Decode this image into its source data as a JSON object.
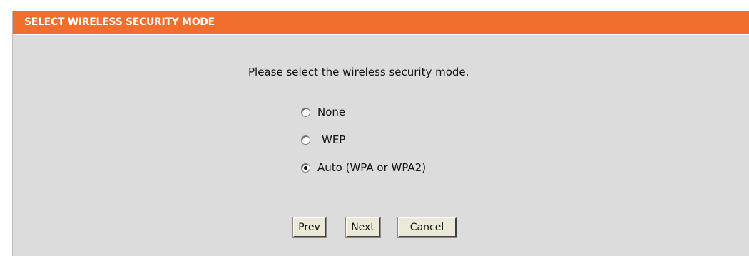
{
  "header": {
    "title": "SELECT WIRELESS SECURITY MODE"
  },
  "main": {
    "prompt": "Please select the wireless security mode.",
    "options": [
      {
        "label": "None",
        "selected": false
      },
      {
        "label": "WEP",
        "selected": false
      },
      {
        "label": "Auto (WPA or WPA2)",
        "selected": true
      }
    ]
  },
  "buttons": {
    "prev": "Prev",
    "next": "Next",
    "cancel": "Cancel"
  },
  "colors": {
    "header_bg": "#f06e2e",
    "panel_bg": "#dcdcdc"
  }
}
